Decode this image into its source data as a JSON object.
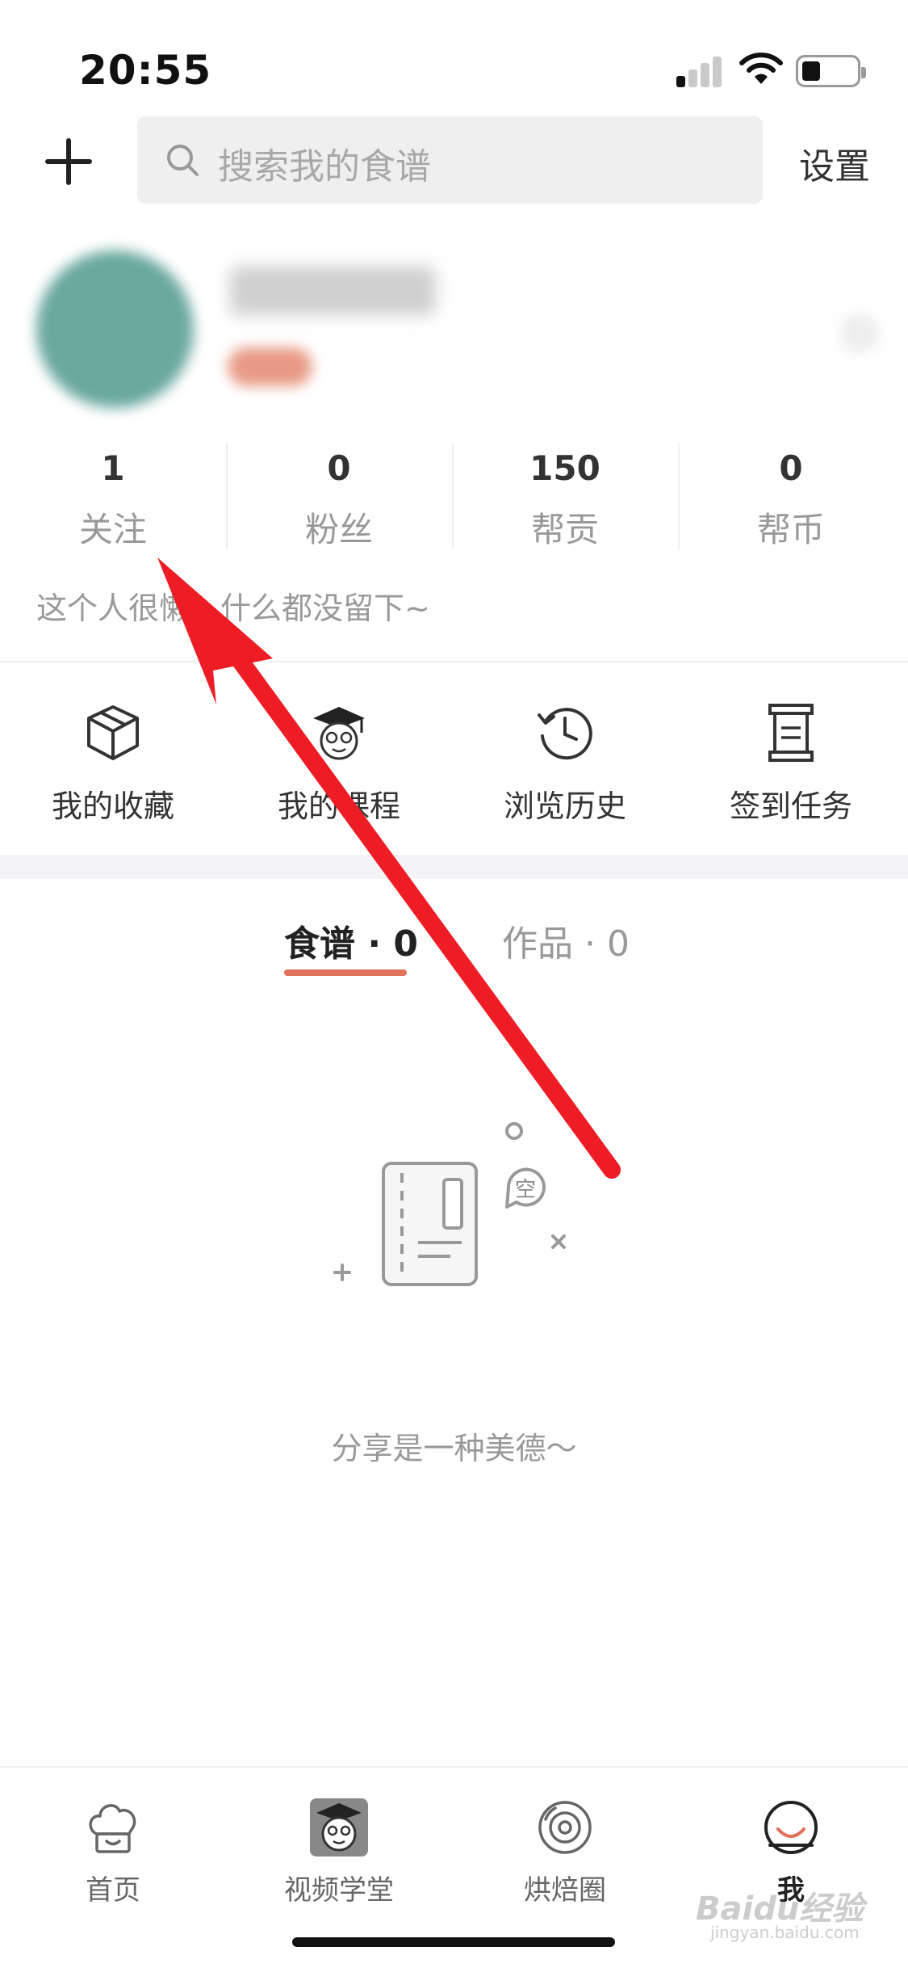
{
  "status_bar": {
    "time": "20:55"
  },
  "header": {
    "search_placeholder": "搜索我的食谱",
    "settings_label": "设置"
  },
  "stats": [
    {
      "value": "1",
      "label": "关注"
    },
    {
      "value": "0",
      "label": "粉丝"
    },
    {
      "value": "150",
      "label": "帮贡"
    },
    {
      "value": "0",
      "label": "帮币"
    }
  ],
  "bio": "这个人很懒，什么都没留下~",
  "quick_actions": [
    {
      "label": "我的收藏",
      "icon": "box-icon"
    },
    {
      "label": "我的课程",
      "icon": "graduate-mascot-icon"
    },
    {
      "label": "浏览历史",
      "icon": "history-clock-icon"
    },
    {
      "label": "签到任务",
      "icon": "scroll-icon"
    }
  ],
  "tabs": [
    {
      "label": "食谱 · 0",
      "active": true
    },
    {
      "label": "作品 · 0",
      "active": false
    }
  ],
  "empty_state": {
    "bubble_text": "空",
    "message": "分享是一种美德～"
  },
  "bottom_nav": [
    {
      "label": "首页",
      "icon": "chef-hat-icon"
    },
    {
      "label": "视频学堂",
      "icon": "graduate-mascot-icon"
    },
    {
      "label": "烘焙圈",
      "icon": "baking-circle-icon"
    },
    {
      "label": "我",
      "icon": "profile-icon",
      "active": true
    }
  ],
  "watermark": {
    "brand": "Baidu经验",
    "url": "jingyan.baidu.com"
  },
  "colors": {
    "accent": "#e0715a",
    "arrow": "#ee1c24",
    "muted": "#999999"
  }
}
